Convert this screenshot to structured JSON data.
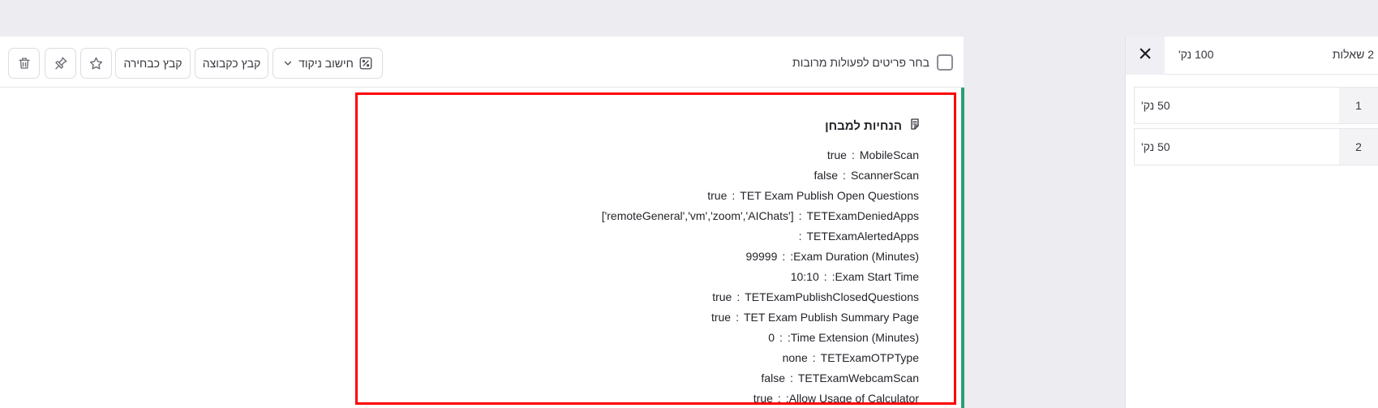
{
  "toolbar": {
    "select_all_label": "בחר פריטים לפעולות מרובות",
    "scoring_label": "חישוב ניקוד",
    "file_as_group_label": "קבץ כקבוצה",
    "file_as_selection_label": "קבץ כבחירה",
    "icons": [
      "trash-icon",
      "pin-icon",
      "star-icon",
      "percent-calc-icon",
      "chevron-down-icon"
    ]
  },
  "instructions": {
    "title": "הנחיות למבחן",
    "title_icon": "instructions-icon",
    "lines": [
      {
        "key": "MobileScan",
        "sep": ":",
        "val": "true"
      },
      {
        "key": "ScannerScan",
        "sep": ":",
        "val": "false"
      },
      {
        "key": "TET Exam Publish Open Questions",
        "sep": ":",
        "val": "true"
      },
      {
        "key": "TETExamDeniedApps",
        "sep": ":",
        "val": "['remoteGeneral','vm','zoom','AIChats']"
      },
      {
        "key": "TETExamAlertedApps",
        "sep": ":",
        "val": ""
      },
      {
        "key": "Exam Duration (Minutes):",
        "sep": ":",
        "val": "99999"
      },
      {
        "key": "Exam Start Time:",
        "sep": ":",
        "val": "10:10"
      },
      {
        "key": "TETExamPublishClosedQuestions",
        "sep": ":",
        "val": "true"
      },
      {
        "key": "TET Exam Publish Summary Page",
        "sep": ":",
        "val": "true"
      },
      {
        "key": "Time Extension (Minutes):",
        "sep": ":",
        "val": "0"
      },
      {
        "key": "TETExamOTPType",
        "sep": ":",
        "val": "none"
      },
      {
        "key": "TETExamWebcamScan",
        "sep": ":",
        "val": "false"
      },
      {
        "key": "Allow Usage of Calculator:",
        "sep": ":",
        "val": "true"
      }
    ]
  },
  "sidebar": {
    "question_count": "2 שאלות",
    "total_points": "100 נק'",
    "close_icon": "close-icon",
    "questions": [
      {
        "number": "1",
        "points": "50 נק'"
      },
      {
        "number": "2",
        "points": "50 נק'"
      }
    ]
  },
  "colors": {
    "highlight_border": "#ff0000",
    "accent_green": "#2e9e77",
    "page_background": "#ececf1"
  }
}
